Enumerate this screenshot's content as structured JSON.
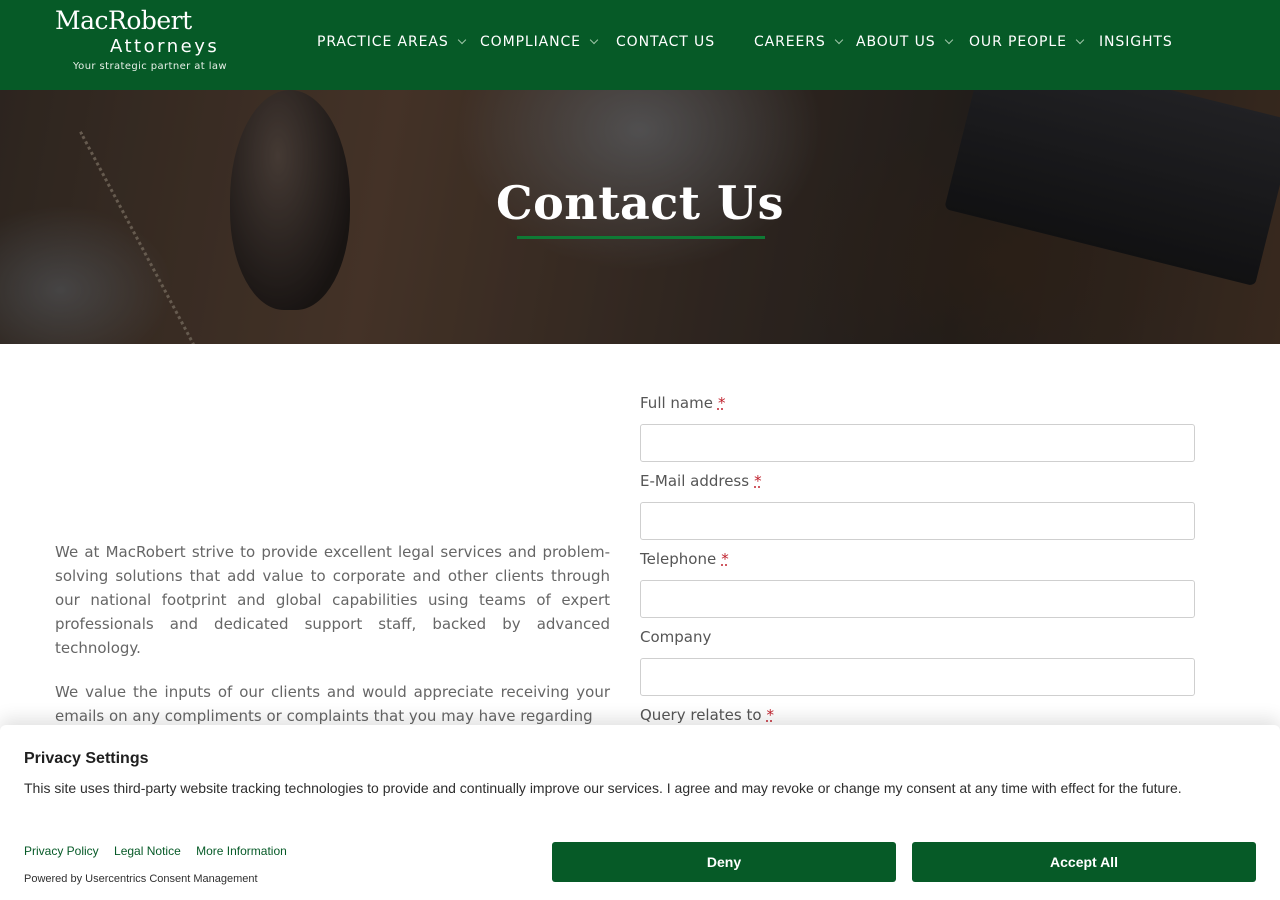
{
  "brand": {
    "name": "MacRobert",
    "sub": "Attorneys",
    "tagline": "Your strategic partner at law",
    "color": "#065a27"
  },
  "nav": {
    "items": [
      {
        "label": "PRACTICE AREAS",
        "has_dropdown": true
      },
      {
        "label": "COMPLIANCE",
        "has_dropdown": true
      },
      {
        "label": "CONTACT US",
        "has_dropdown": false
      },
      {
        "label": "CAREERS",
        "has_dropdown": true
      },
      {
        "label": "ABOUT US",
        "has_dropdown": true
      },
      {
        "label": "OUR PEOPLE",
        "has_dropdown": true
      },
      {
        "label": "INSIGHTS",
        "has_dropdown": false
      }
    ]
  },
  "hero": {
    "title": "Contact Us"
  },
  "intro": {
    "paragraphs": [
      "We at MacRobert strive to provide excellent legal services and problem-solving solutions that add value to corporate and other clients through our national footprint and global capabilities using teams of expert professionals and dedicated support staff, backed by advanced technology.",
      "We value the inputs of our clients and would appreciate receiving your emails on any compliments or complaints that you may have regarding"
    ]
  },
  "form": {
    "required_marker": "*",
    "fields": [
      {
        "label": "Full name",
        "required": true,
        "value": ""
      },
      {
        "label": "E-Mail address",
        "required": true,
        "value": ""
      },
      {
        "label": "Telephone",
        "required": true,
        "value": ""
      },
      {
        "label": "Company",
        "required": false,
        "value": ""
      },
      {
        "label": "Query relates to",
        "required": true
      }
    ]
  },
  "consent": {
    "title": "Privacy Settings",
    "text": "This site uses third-party website tracking technologies to provide and continually improve our services. I agree and may revoke or change my consent at any time with effect for the future.",
    "links": [
      "Privacy Policy",
      "Legal Notice",
      "More Information"
    ],
    "powered_by": "Powered by Usercentrics Consent Management",
    "deny_label": "Deny",
    "accept_label": "Accept All"
  }
}
